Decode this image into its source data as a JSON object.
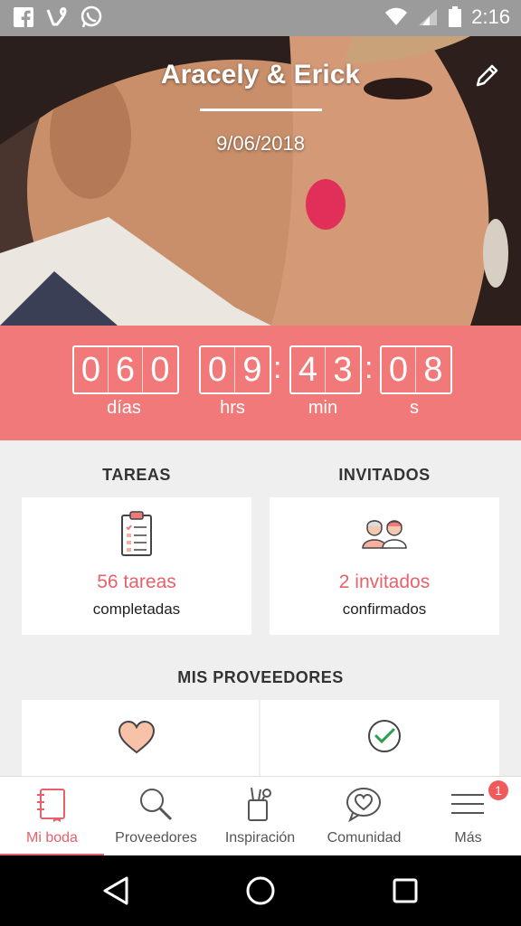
{
  "status_bar": {
    "time": "2:16",
    "left_icons": [
      "facebook-icon",
      "vine-icon",
      "whatsapp-icon"
    ],
    "right_icons": [
      "wifi-icon",
      "signal-icon",
      "battery-icon"
    ]
  },
  "hero": {
    "couple_name": "Aracely & Erick",
    "wedding_date": "9/06/2018"
  },
  "countdown": {
    "days": [
      "0",
      "6",
      "0"
    ],
    "hours": [
      "0",
      "9"
    ],
    "minutes": [
      "4",
      "3"
    ],
    "seconds": [
      "0",
      "8"
    ],
    "labels": {
      "days": "días",
      "hours": "hrs",
      "minutes": "min",
      "seconds": "s"
    }
  },
  "tasks": {
    "title": "TAREAS",
    "count_text": "56 tareas",
    "sub_text": "completadas"
  },
  "guests": {
    "title": "INVITADOS",
    "count_text": "2 invitados",
    "sub_text": "confirmados"
  },
  "providers": {
    "title": "MIS PROVEEDORES"
  },
  "bottom_nav": {
    "items": [
      {
        "label": "Mi boda",
        "icon": "notebook-icon"
      },
      {
        "label": "Proveedores",
        "icon": "search-icon"
      },
      {
        "label": "Inspiración",
        "icon": "pencil-cup-icon"
      },
      {
        "label": "Comunidad",
        "icon": "chat-heart-icon"
      },
      {
        "label": "Más",
        "icon": "menu-icon"
      }
    ],
    "badge": "1"
  },
  "colors": {
    "accent": "#f27979",
    "accent_text": "#e8606a"
  }
}
